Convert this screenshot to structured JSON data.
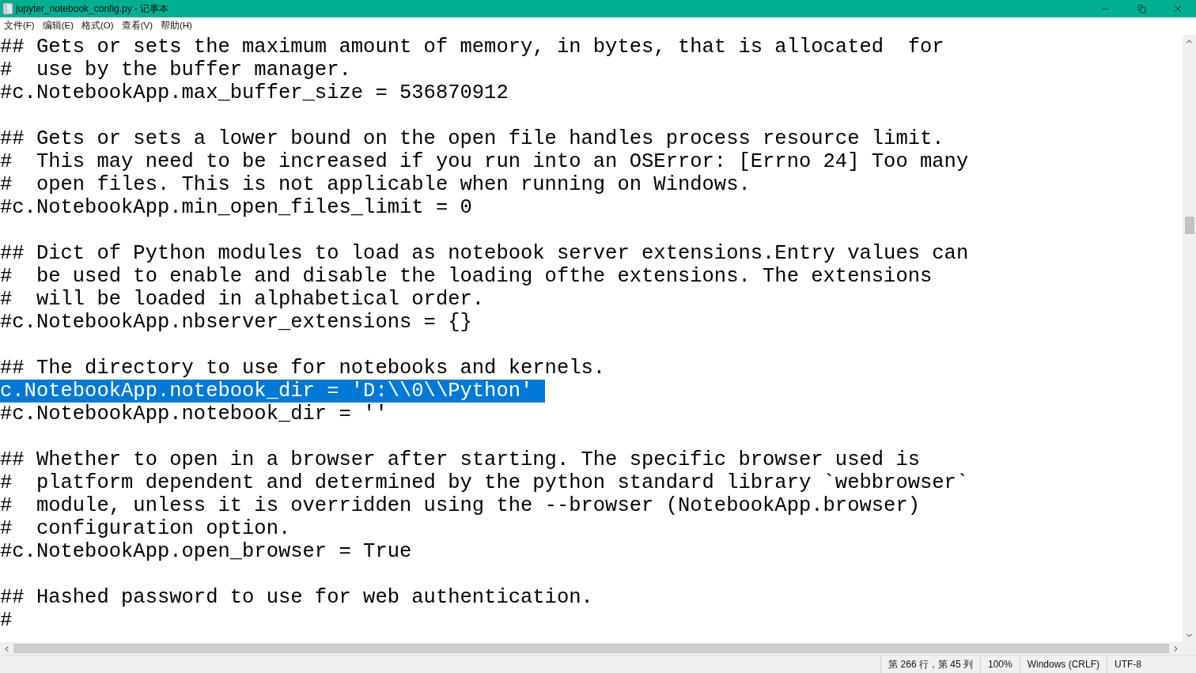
{
  "window": {
    "title": "jupyter_notebook_config.py - 记事本"
  },
  "menu": [
    "文件(F)",
    "编辑(E)",
    "格式(O)",
    "查看(V)",
    "帮助(H)"
  ],
  "editor": {
    "blocks": [
      {
        "lines": [
          {
            "text": "## Gets or sets the maximum amount of memory, in bytes, that is allocated  for",
            "selected": false
          },
          {
            "text": "#  use by the buffer manager.",
            "selected": false
          },
          {
            "text": "#c.NotebookApp.max_buffer_size = 536870912",
            "selected": false
          }
        ]
      },
      {
        "lines": [
          {
            "text": "## Gets or sets a lower bound on the open file handles process resource limit.",
            "selected": false
          },
          {
            "text": "#  This may need to be increased if you run into an OSError: [Errno 24] Too many",
            "selected": false
          },
          {
            "text": "#  open files. This is not applicable when running on Windows.",
            "selected": false
          },
          {
            "text": "#c.NotebookApp.min_open_files_limit = 0",
            "selected": false
          }
        ]
      },
      {
        "lines": [
          {
            "text": "## Dict of Python modules to load as notebook server extensions.Entry values can",
            "selected": false
          },
          {
            "text": "#  be used to enable and disable the loading ofthe extensions. The extensions",
            "selected": false
          },
          {
            "text": "#  will be loaded in alphabetical order.",
            "selected": false
          },
          {
            "text": "#c.NotebookApp.nbserver_extensions = {}",
            "selected": false
          }
        ]
      },
      {
        "lines": [
          {
            "text": "## The directory to use for notebooks and kernels.",
            "selected": false
          },
          {
            "text": "c.NotebookApp.notebook_dir = 'D:\\\\0\\\\Python' ",
            "selected": true
          },
          {
            "text": "#c.NotebookApp.notebook_dir = ''",
            "selected": false
          }
        ]
      },
      {
        "lines": [
          {
            "text": "## Whether to open in a browser after starting. The specific browser used is",
            "selected": false
          },
          {
            "text": "#  platform dependent and determined by the python standard library `webbrowser`",
            "selected": false
          },
          {
            "text": "#  module, unless it is overridden using the --browser (NotebookApp.browser)",
            "selected": false
          },
          {
            "text": "#  configuration option.",
            "selected": false
          },
          {
            "text": "#c.NotebookApp.open_browser = True",
            "selected": false
          }
        ]
      },
      {
        "lines": [
          {
            "text": "## Hashed password to use for web authentication.",
            "selected": false
          },
          {
            "text": "#",
            "selected": false
          }
        ]
      }
    ]
  },
  "status_bar": [
    "第 266 行，第 45 列",
    "100%",
    "Windows (CRLF)",
    "UTF-8"
  ]
}
